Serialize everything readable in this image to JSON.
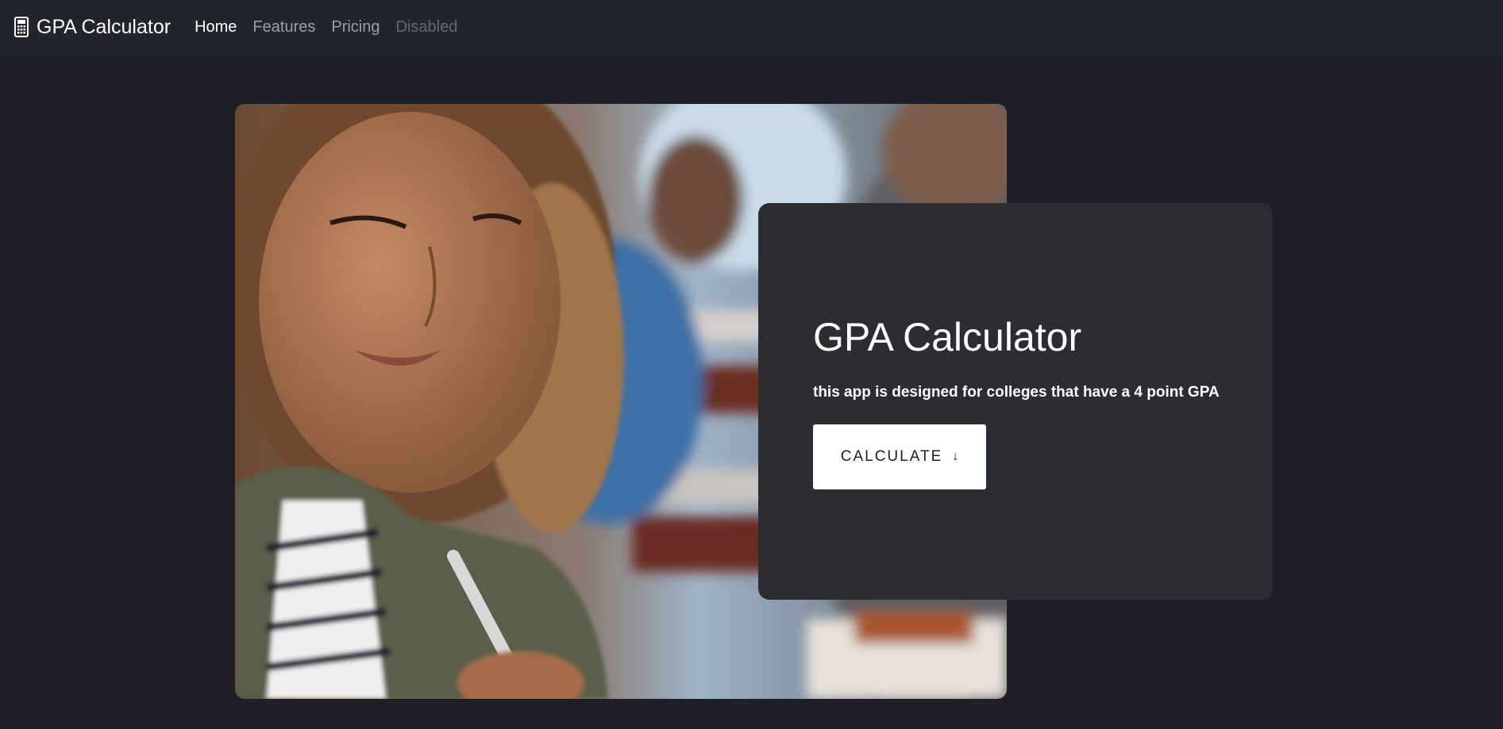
{
  "navbar": {
    "brand_label": "GPA Calculator",
    "brand_icon": "calculator-icon",
    "links": [
      {
        "label": "Home",
        "state": "active"
      },
      {
        "label": "Features",
        "state": "normal"
      },
      {
        "label": "Pricing",
        "state": "normal"
      },
      {
        "label": "Disabled",
        "state": "disabled"
      }
    ]
  },
  "hero": {
    "image_subject": "student-writing-photo",
    "title": "GPA Calculator",
    "subtitle": "this app is designed for colleges that have a 4 point GPA",
    "button_label": "CALCULATE",
    "button_icon": "↓"
  },
  "colors": {
    "page_bg": "#1e1f27",
    "navbar_bg": "#23252c",
    "card_bg": "#2c2d33",
    "button_bg": "#ffffff"
  }
}
